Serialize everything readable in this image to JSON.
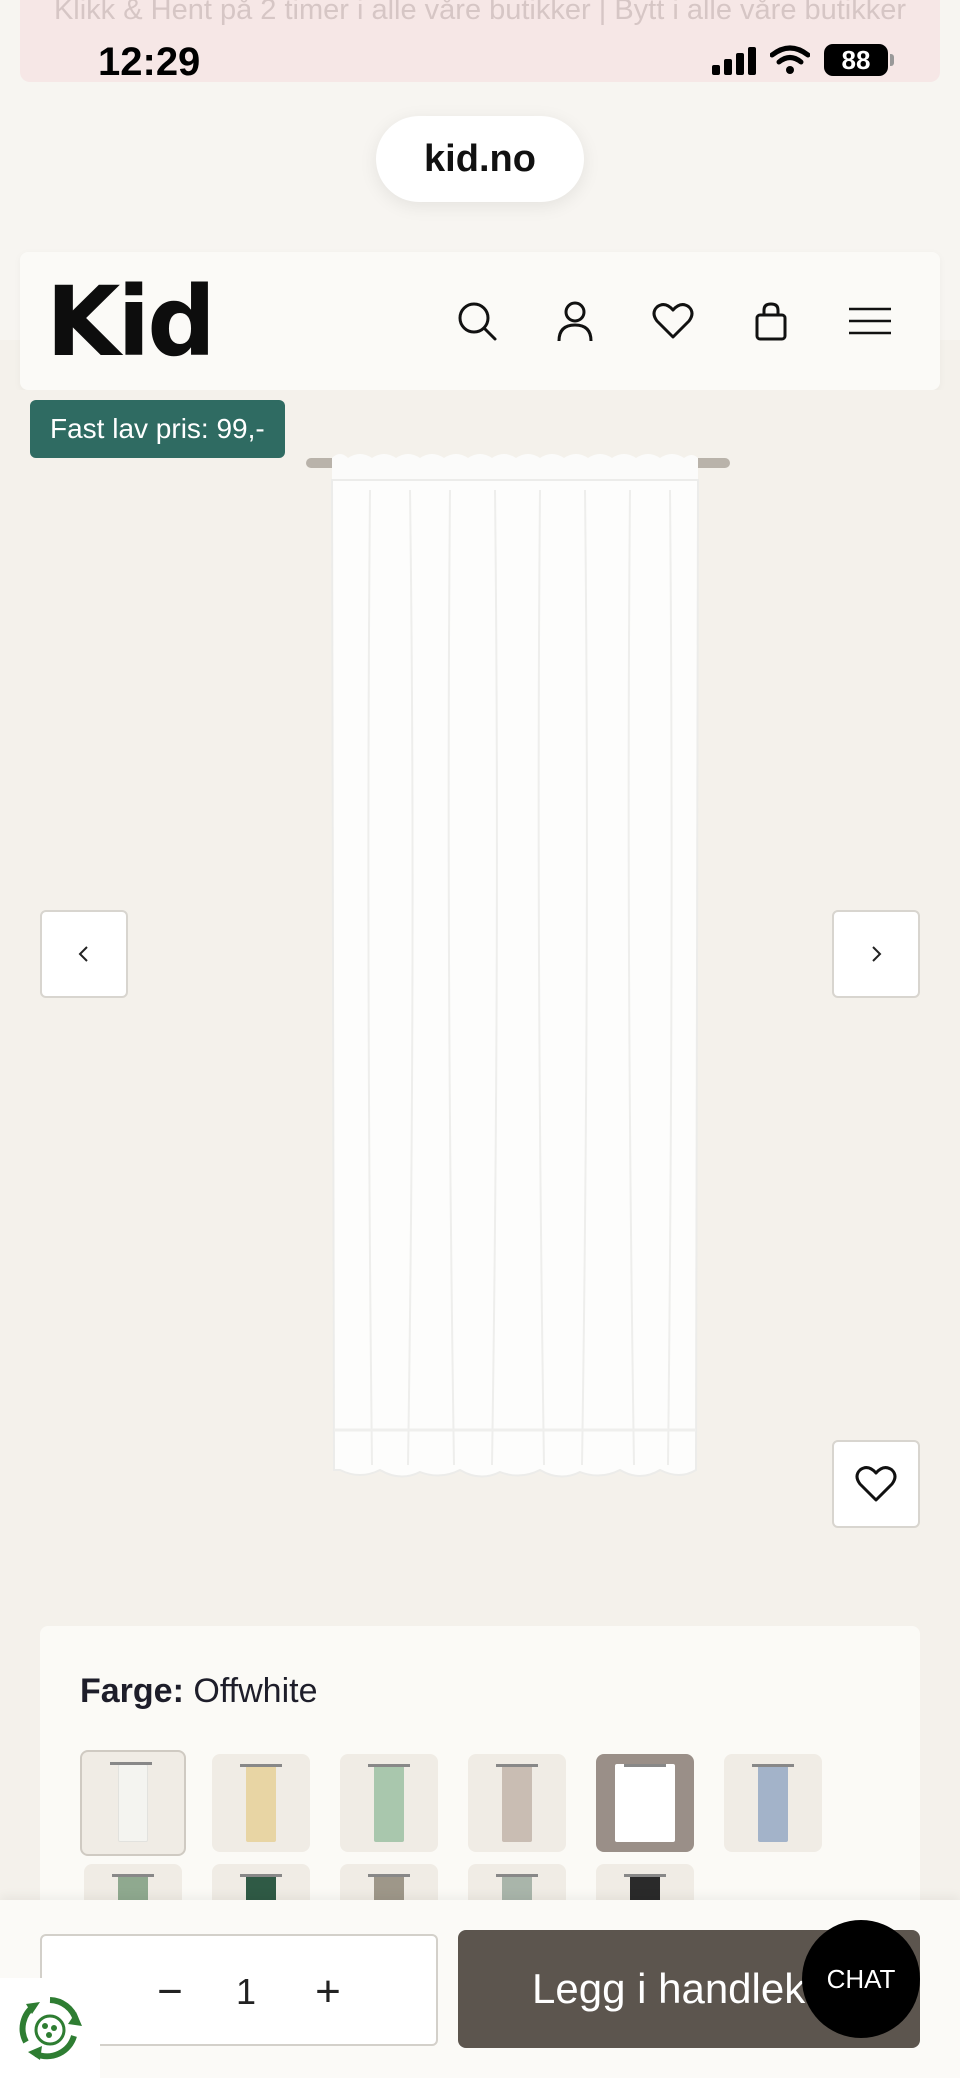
{
  "promo": {
    "text": "Klikk & Hent på 2 timer i alle våre butikker | Bytt i alle våre butikker"
  },
  "status_bar": {
    "time": "12:29",
    "battery": "88"
  },
  "browser": {
    "url": "kid.no"
  },
  "header": {
    "logo": "Kid",
    "icons": [
      "search-icon",
      "account-icon",
      "wishlist-icon",
      "cart-icon",
      "menu-icon"
    ]
  },
  "product": {
    "price_badge": "Fast lav pris: 99,-"
  },
  "color": {
    "label": "Farge:",
    "value": "Offwhite",
    "swatches": [
      {
        "color": "#f4f4f0"
      },
      {
        "color": "#e8d5a4"
      },
      {
        "color": "#a9c7ad"
      },
      {
        "color": "#c9bdb3"
      },
      {
        "color": "#ffffff"
      },
      {
        "color": "#a3b3c9"
      },
      {
        "color": "#8fa98f"
      },
      {
        "color": "#2f5a45"
      },
      {
        "color": "#9e9789"
      },
      {
        "color": "#a9b5aa"
      },
      {
        "color": "#2a2a2a"
      }
    ]
  },
  "cart": {
    "quantity": "1",
    "minus": "−",
    "plus": "+",
    "add_label": "Legg i handlekurv"
  },
  "chat": {
    "label": "CHAT"
  }
}
